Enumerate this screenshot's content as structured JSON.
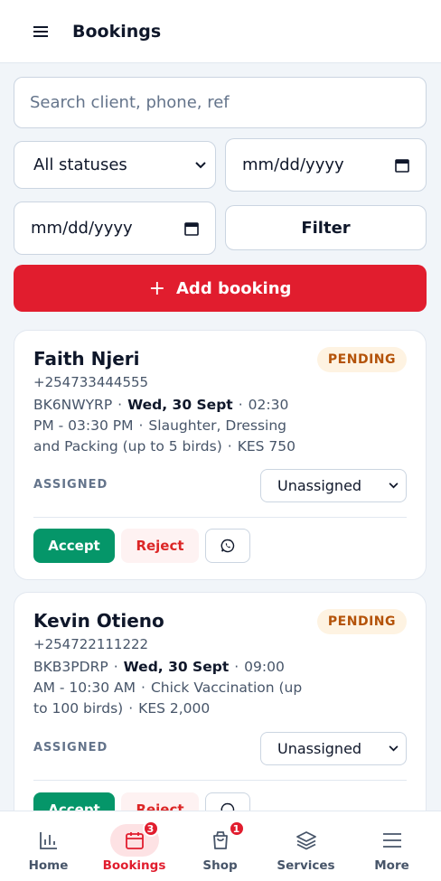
{
  "header": {
    "title": "Bookings",
    "menu_icon": "hamburger-menu-icon"
  },
  "search": {
    "placeholder": "Search client, phone, ref"
  },
  "filters": {
    "status_selected": "All statuses",
    "date_from_placeholder": "mm/dd/yyyy",
    "date_to_placeholder": "mm/dd/yyyy",
    "filter_label": "Filter"
  },
  "add_booking": {
    "icon": "+",
    "label": "Add booking"
  },
  "bookings": [
    {
      "name": "Faith Njeri",
      "phone": "+254733444555",
      "status": "PENDING",
      "ref": "BK6NWYRP",
      "date": "Wed, 30 Sept",
      "time": "02:30 PM - 03:30 PM",
      "service": "Slaughter, Dressing and Packing (up to 5 birds)",
      "amount": "KES 750",
      "assigned_label": "ASSIGNED",
      "assigned_value": "Unassigned",
      "accept_label": "Accept",
      "reject_label": "Reject"
    },
    {
      "name": "Kevin Otieno",
      "phone": "+254722111222",
      "status": "PENDING",
      "ref": "BKB3PDRP",
      "date": "Wed, 30 Sept",
      "time": "09:00 AM - 10:30 AM",
      "service": "Chick Vaccination (up to 100 birds)",
      "amount": "KES 2,000",
      "assigned_label": "ASSIGNED",
      "assigned_value": "Unassigned",
      "accept_label": "Accept",
      "reject_label": "Reject"
    }
  ],
  "separator": "·",
  "nav": {
    "items": [
      {
        "label": "Home",
        "icon": "bar-chart-icon"
      },
      {
        "label": "Bookings",
        "icon": "calendar-icon",
        "badge": "3",
        "active": true
      },
      {
        "label": "Shop",
        "icon": "shopping-bag-icon",
        "badge": "1"
      },
      {
        "label": "Services",
        "icon": "layers-icon"
      },
      {
        "label": "More",
        "icon": "hamburger-menu-icon"
      }
    ]
  },
  "colors": {
    "brand": "#e11d2e",
    "accept": "#059669",
    "pending_bg": "#fef3e2",
    "pending_text": "#b45309"
  }
}
